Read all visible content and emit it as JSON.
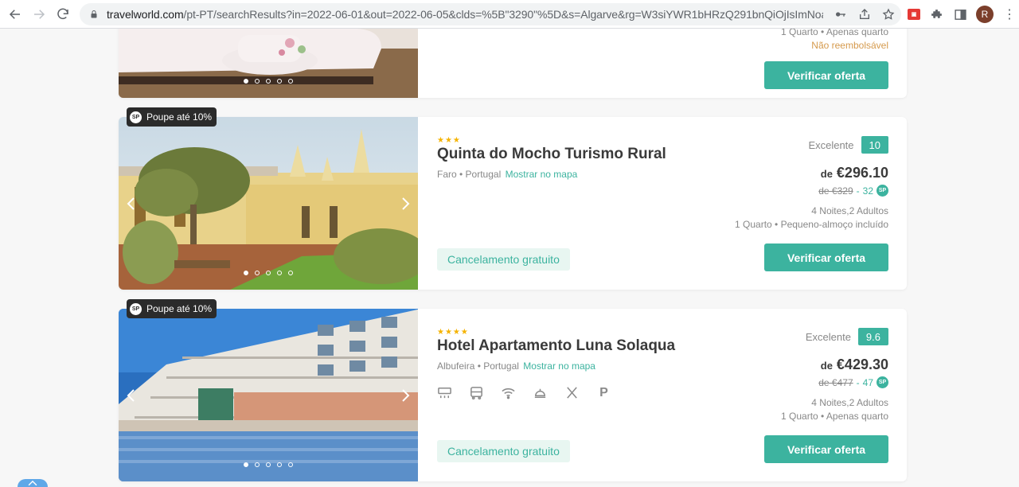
{
  "browser": {
    "url_host": "travelworld.com",
    "url_path": "/pt-PT/searchResults?in=2022-06-01&out=2022-06-05&clds=%5B\"3290\"%5D&s=Algarve&rg=W3siYWR1bHRzQ291bnQiOjIsImNoaWx...",
    "avatar_letter": "R"
  },
  "hotels": [
    {
      "meta_line_1": "1 Quarto • Apenas quarto",
      "meta_line_2": "Não reembolsável",
      "cta": "Verificar oferta"
    },
    {
      "badge": "Poupe até 10%",
      "stars": "★★★",
      "name": "Quinta do Mocho Turismo Rural",
      "location": "Faro • Portugal",
      "map_link": "Mostrar no mapa",
      "rating_label": "Excelente",
      "rating_score": "10",
      "price_from": "de",
      "price": "€296.10",
      "old_price": "de €329",
      "points": "32",
      "stay": "4 Noites,2 Adultos",
      "room": "1 Quarto • Pequeno-almoço incluído",
      "cancel": "Cancelamento gratuito",
      "cta": "Verificar oferta"
    },
    {
      "badge": "Poupe até 10%",
      "stars": "★★★★",
      "name": "Hotel Apartamento Luna Solaqua",
      "location": "Albufeira • Portugal",
      "map_link": "Mostrar no mapa",
      "rating_label": "Excelente",
      "rating_score": "9.6",
      "price_from": "de",
      "price": "€429.30",
      "old_price": "de €477",
      "points": "47",
      "stay": "4 Noites,2 Adultos",
      "room": "1 Quarto • Apenas quarto",
      "cancel": "Cancelamento gratuito",
      "cta": "Verificar oferta",
      "amenities": [
        "air-conditioning-icon",
        "shuttle-bus-icon",
        "wifi-icon",
        "room-service-icon",
        "restaurant-icon",
        "parking-icon"
      ]
    }
  ],
  "sp_label": "SP",
  "colors": {
    "accent": "#3cb39f",
    "star": "#f5b301",
    "badge": "#2b2b2b"
  }
}
